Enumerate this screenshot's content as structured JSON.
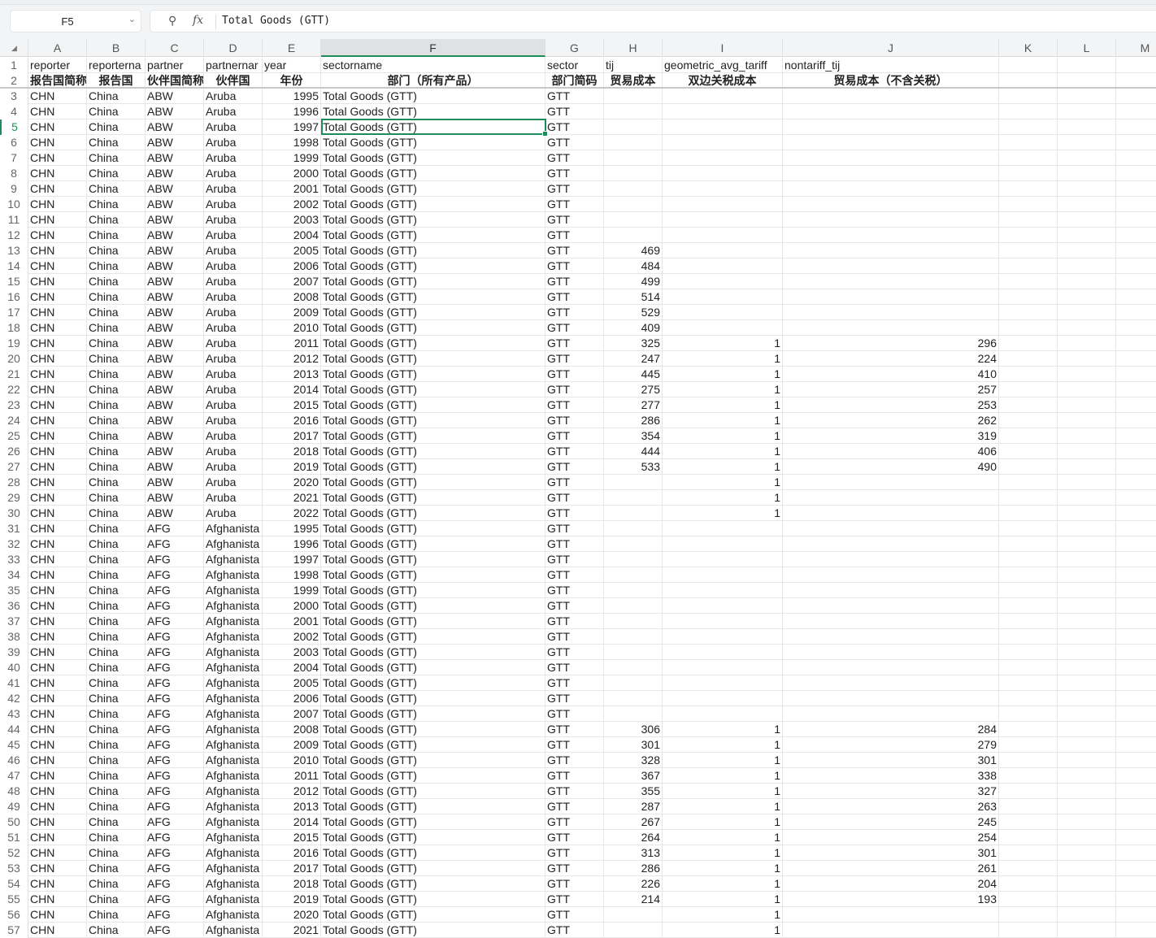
{
  "formula_bar": {
    "cell_ref": "F5",
    "formula": "Total Goods (GTT)",
    "zoom_icon": "zoom-icon",
    "fx_label": "fx"
  },
  "columns": [
    "A",
    "B",
    "C",
    "D",
    "E",
    "F",
    "G",
    "H",
    "I",
    "J",
    "K",
    "L",
    "M"
  ],
  "selected": {
    "column": "F",
    "row": 5
  },
  "header_row_1": [
    "reporter",
    "reporterna",
    "partner",
    "partnernar",
    "year",
    "sectorname",
    "sector",
    "tij",
    "geometric_avg_tariff",
    "nontariff_tij"
  ],
  "header_row_2": [
    "报告国简称",
    "报告国",
    "伙伴国简称",
    "伙伴国",
    "年份",
    "部门（所有产品）",
    "部门简码",
    "贸易成本",
    "双边关税成本",
    "贸易成本（不含关税）"
  ],
  "rows": [
    [
      "CHN",
      "China",
      "ABW",
      "Aruba",
      "1995",
      "Total Goods (GTT)",
      "GTT",
      "",
      "",
      ""
    ],
    [
      "CHN",
      "China",
      "ABW",
      "Aruba",
      "1996",
      "Total Goods (GTT)",
      "GTT",
      "",
      "",
      ""
    ],
    [
      "CHN",
      "China",
      "ABW",
      "Aruba",
      "1997",
      "Total Goods (GTT)",
      "GTT",
      "",
      "",
      ""
    ],
    [
      "CHN",
      "China",
      "ABW",
      "Aruba",
      "1998",
      "Total Goods (GTT)",
      "GTT",
      "",
      "",
      ""
    ],
    [
      "CHN",
      "China",
      "ABW",
      "Aruba",
      "1999",
      "Total Goods (GTT)",
      "GTT",
      "",
      "",
      ""
    ],
    [
      "CHN",
      "China",
      "ABW",
      "Aruba",
      "2000",
      "Total Goods (GTT)",
      "GTT",
      "",
      "",
      ""
    ],
    [
      "CHN",
      "China",
      "ABW",
      "Aruba",
      "2001",
      "Total Goods (GTT)",
      "GTT",
      "",
      "",
      ""
    ],
    [
      "CHN",
      "China",
      "ABW",
      "Aruba",
      "2002",
      "Total Goods (GTT)",
      "GTT",
      "",
      "",
      ""
    ],
    [
      "CHN",
      "China",
      "ABW",
      "Aruba",
      "2003",
      "Total Goods (GTT)",
      "GTT",
      "",
      "",
      ""
    ],
    [
      "CHN",
      "China",
      "ABW",
      "Aruba",
      "2004",
      "Total Goods (GTT)",
      "GTT",
      "",
      "",
      ""
    ],
    [
      "CHN",
      "China",
      "ABW",
      "Aruba",
      "2005",
      "Total Goods (GTT)",
      "GTT",
      "469",
      "",
      ""
    ],
    [
      "CHN",
      "China",
      "ABW",
      "Aruba",
      "2006",
      "Total Goods (GTT)",
      "GTT",
      "484",
      "",
      ""
    ],
    [
      "CHN",
      "China",
      "ABW",
      "Aruba",
      "2007",
      "Total Goods (GTT)",
      "GTT",
      "499",
      "",
      ""
    ],
    [
      "CHN",
      "China",
      "ABW",
      "Aruba",
      "2008",
      "Total Goods (GTT)",
      "GTT",
      "514",
      "",
      ""
    ],
    [
      "CHN",
      "China",
      "ABW",
      "Aruba",
      "2009",
      "Total Goods (GTT)",
      "GTT",
      "529",
      "",
      ""
    ],
    [
      "CHN",
      "China",
      "ABW",
      "Aruba",
      "2010",
      "Total Goods (GTT)",
      "GTT",
      "409",
      "",
      ""
    ],
    [
      "CHN",
      "China",
      "ABW",
      "Aruba",
      "2011",
      "Total Goods (GTT)",
      "GTT",
      "325",
      "1",
      "296"
    ],
    [
      "CHN",
      "China",
      "ABW",
      "Aruba",
      "2012",
      "Total Goods (GTT)",
      "GTT",
      "247",
      "1",
      "224"
    ],
    [
      "CHN",
      "China",
      "ABW",
      "Aruba",
      "2013",
      "Total Goods (GTT)",
      "GTT",
      "445",
      "1",
      "410"
    ],
    [
      "CHN",
      "China",
      "ABW",
      "Aruba",
      "2014",
      "Total Goods (GTT)",
      "GTT",
      "275",
      "1",
      "257"
    ],
    [
      "CHN",
      "China",
      "ABW",
      "Aruba",
      "2015",
      "Total Goods (GTT)",
      "GTT",
      "277",
      "1",
      "253"
    ],
    [
      "CHN",
      "China",
      "ABW",
      "Aruba",
      "2016",
      "Total Goods (GTT)",
      "GTT",
      "286",
      "1",
      "262"
    ],
    [
      "CHN",
      "China",
      "ABW",
      "Aruba",
      "2017",
      "Total Goods (GTT)",
      "GTT",
      "354",
      "1",
      "319"
    ],
    [
      "CHN",
      "China",
      "ABW",
      "Aruba",
      "2018",
      "Total Goods (GTT)",
      "GTT",
      "444",
      "1",
      "406"
    ],
    [
      "CHN",
      "China",
      "ABW",
      "Aruba",
      "2019",
      "Total Goods (GTT)",
      "GTT",
      "533",
      "1",
      "490"
    ],
    [
      "CHN",
      "China",
      "ABW",
      "Aruba",
      "2020",
      "Total Goods (GTT)",
      "GTT",
      "",
      "1",
      ""
    ],
    [
      "CHN",
      "China",
      "ABW",
      "Aruba",
      "2021",
      "Total Goods (GTT)",
      "GTT",
      "",
      "1",
      ""
    ],
    [
      "CHN",
      "China",
      "ABW",
      "Aruba",
      "2022",
      "Total Goods (GTT)",
      "GTT",
      "",
      "1",
      ""
    ],
    [
      "CHN",
      "China",
      "AFG",
      "Afghanista",
      "1995",
      "Total Goods (GTT)",
      "GTT",
      "",
      "",
      ""
    ],
    [
      "CHN",
      "China",
      "AFG",
      "Afghanista",
      "1996",
      "Total Goods (GTT)",
      "GTT",
      "",
      "",
      ""
    ],
    [
      "CHN",
      "China",
      "AFG",
      "Afghanista",
      "1997",
      "Total Goods (GTT)",
      "GTT",
      "",
      "",
      ""
    ],
    [
      "CHN",
      "China",
      "AFG",
      "Afghanista",
      "1998",
      "Total Goods (GTT)",
      "GTT",
      "",
      "",
      ""
    ],
    [
      "CHN",
      "China",
      "AFG",
      "Afghanista",
      "1999",
      "Total Goods (GTT)",
      "GTT",
      "",
      "",
      ""
    ],
    [
      "CHN",
      "China",
      "AFG",
      "Afghanista",
      "2000",
      "Total Goods (GTT)",
      "GTT",
      "",
      "",
      ""
    ],
    [
      "CHN",
      "China",
      "AFG",
      "Afghanista",
      "2001",
      "Total Goods (GTT)",
      "GTT",
      "",
      "",
      ""
    ],
    [
      "CHN",
      "China",
      "AFG",
      "Afghanista",
      "2002",
      "Total Goods (GTT)",
      "GTT",
      "",
      "",
      ""
    ],
    [
      "CHN",
      "China",
      "AFG",
      "Afghanista",
      "2003",
      "Total Goods (GTT)",
      "GTT",
      "",
      "",
      ""
    ],
    [
      "CHN",
      "China",
      "AFG",
      "Afghanista",
      "2004",
      "Total Goods (GTT)",
      "GTT",
      "",
      "",
      ""
    ],
    [
      "CHN",
      "China",
      "AFG",
      "Afghanista",
      "2005",
      "Total Goods (GTT)",
      "GTT",
      "",
      "",
      ""
    ],
    [
      "CHN",
      "China",
      "AFG",
      "Afghanista",
      "2006",
      "Total Goods (GTT)",
      "GTT",
      "",
      "",
      ""
    ],
    [
      "CHN",
      "China",
      "AFG",
      "Afghanista",
      "2007",
      "Total Goods (GTT)",
      "GTT",
      "",
      "",
      ""
    ],
    [
      "CHN",
      "China",
      "AFG",
      "Afghanista",
      "2008",
      "Total Goods (GTT)",
      "GTT",
      "306",
      "1",
      "284"
    ],
    [
      "CHN",
      "China",
      "AFG",
      "Afghanista",
      "2009",
      "Total Goods (GTT)",
      "GTT",
      "301",
      "1",
      "279"
    ],
    [
      "CHN",
      "China",
      "AFG",
      "Afghanista",
      "2010",
      "Total Goods (GTT)",
      "GTT",
      "328",
      "1",
      "301"
    ],
    [
      "CHN",
      "China",
      "AFG",
      "Afghanista",
      "2011",
      "Total Goods (GTT)",
      "GTT",
      "367",
      "1",
      "338"
    ],
    [
      "CHN",
      "China",
      "AFG",
      "Afghanista",
      "2012",
      "Total Goods (GTT)",
      "GTT",
      "355",
      "1",
      "327"
    ],
    [
      "CHN",
      "China",
      "AFG",
      "Afghanista",
      "2013",
      "Total Goods (GTT)",
      "GTT",
      "287",
      "1",
      "263"
    ],
    [
      "CHN",
      "China",
      "AFG",
      "Afghanista",
      "2014",
      "Total Goods (GTT)",
      "GTT",
      "267",
      "1",
      "245"
    ],
    [
      "CHN",
      "China",
      "AFG",
      "Afghanista",
      "2015",
      "Total Goods (GTT)",
      "GTT",
      "264",
      "1",
      "254"
    ],
    [
      "CHN",
      "China",
      "AFG",
      "Afghanista",
      "2016",
      "Total Goods (GTT)",
      "GTT",
      "313",
      "1",
      "301"
    ],
    [
      "CHN",
      "China",
      "AFG",
      "Afghanista",
      "2017",
      "Total Goods (GTT)",
      "GTT",
      "286",
      "1",
      "261"
    ],
    [
      "CHN",
      "China",
      "AFG",
      "Afghanista",
      "2018",
      "Total Goods (GTT)",
      "GTT",
      "226",
      "1",
      "204"
    ],
    [
      "CHN",
      "China",
      "AFG",
      "Afghanista",
      "2019",
      "Total Goods (GTT)",
      "GTT",
      "214",
      "1",
      "193"
    ],
    [
      "CHN",
      "China",
      "AFG",
      "Afghanista",
      "2020",
      "Total Goods (GTT)",
      "GTT",
      "",
      "1",
      ""
    ],
    [
      "CHN",
      "China",
      "AFG",
      "Afghanista",
      "2021",
      "Total Goods (GTT)",
      "GTT",
      "",
      "1",
      ""
    ]
  ]
}
